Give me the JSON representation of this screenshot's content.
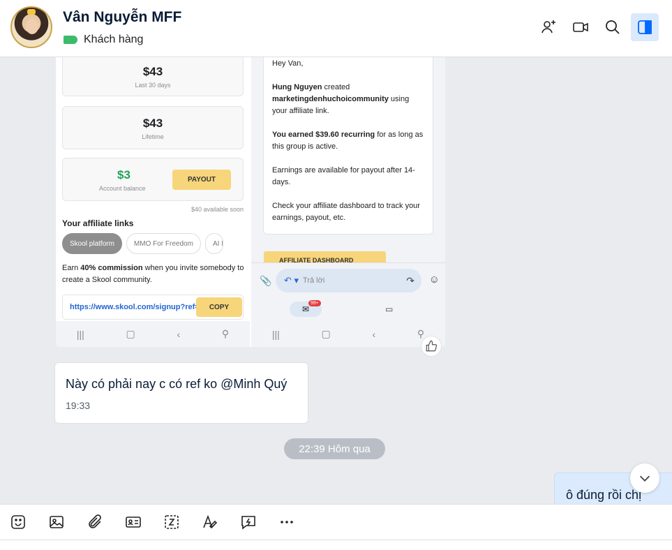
{
  "header": {
    "contact_name": "Vân Nguyễn MFF",
    "tag_label": "Khách hàng",
    "tag_color": "#3cbb6a",
    "icons": [
      "add-member-icon",
      "video-call-icon",
      "search-icon",
      "sidebar-toggle-icon"
    ]
  },
  "screenshot": {
    "left": {
      "stat1_value": "$43",
      "stat1_label": "Last 30 days",
      "stat2_value": "$43",
      "stat2_label": "Lifetime",
      "balance_value": "$3",
      "balance_label": "Account balance",
      "payout_label": "PAYOUT",
      "available_note": "$40 available soon",
      "affiliate_heading": "Your affiliate links",
      "pills": [
        "Skool platform",
        "MMO For Freedom",
        "AI N"
      ],
      "earn_prefix": "Earn ",
      "earn_bold": "40% commission",
      "earn_suffix": " when you invite somebody to create a Skool community.",
      "link_url": "https://www.skool.com/signup?ref=",
      "copy_label": "COPY"
    },
    "right": {
      "greeting": "Hey Van,",
      "created_name": "Hung Nguyen",
      "created_text": " created ",
      "created_group": "marketingdenhuchoicommunity",
      "created_suffix": " using your affiliate link.",
      "earned_bold": "You earned $39.60 recurring",
      "earned_suffix": " for as long as this group is active.",
      "payout_note": "Earnings are available for payout after 14-days.",
      "dashboard_note": "Check your affiliate dashboard to track your earnings, payout, etc.",
      "dashboard_button": "AFFILIATE DASHBOARD",
      "reply_placeholder": "Trả lời",
      "mail_badge": "99+"
    }
  },
  "messages": {
    "incoming_text": "Này có phải nay c có ref ko @Minh Quý",
    "incoming_time": "19:33",
    "date_divider": "22:39 Hôm qua",
    "outgoing_text": "ô đúng rồi chị"
  },
  "toolbar": {
    "items": [
      "sticker-icon",
      "image-icon",
      "attach-icon",
      "contact-card-icon",
      "screenshot-icon",
      "format-text-icon",
      "quick-message-icon",
      "more-icon"
    ]
  }
}
